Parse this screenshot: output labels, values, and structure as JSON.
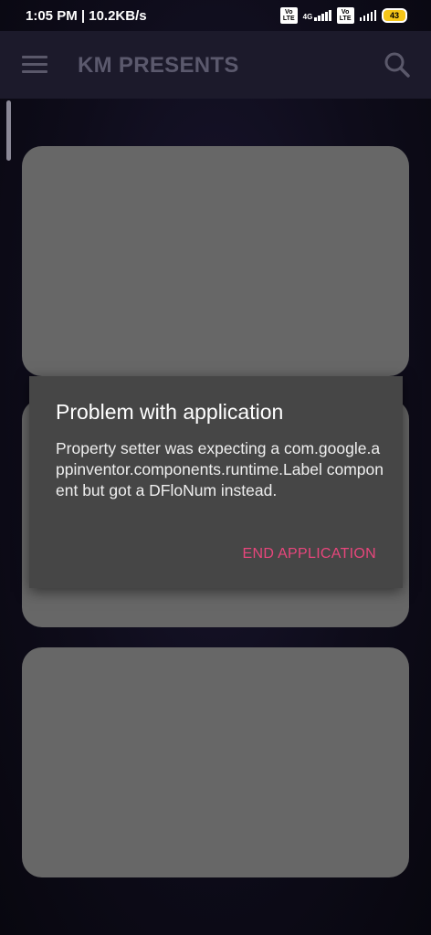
{
  "status_bar": {
    "time": "1:05 PM | 10.2KB/s",
    "volte1": "Vo LTE",
    "network": "4G",
    "volte2": "Vo LTE",
    "battery": "43"
  },
  "app_bar": {
    "title": "KM PRESENTS",
    "menu_icon": "hamburger-menu-icon",
    "search_icon": "search-icon"
  },
  "dialog": {
    "title": "Problem with application",
    "message": "Property setter was expecting a com.google.appinventor.components.runtime.Label component but got a DFloNum instead.",
    "button_label": "END APPLICATION"
  },
  "colors": {
    "app_bar": "#1c1a2b",
    "card": "#676767",
    "dialog": "#464646",
    "accent": "#e8467c"
  }
}
